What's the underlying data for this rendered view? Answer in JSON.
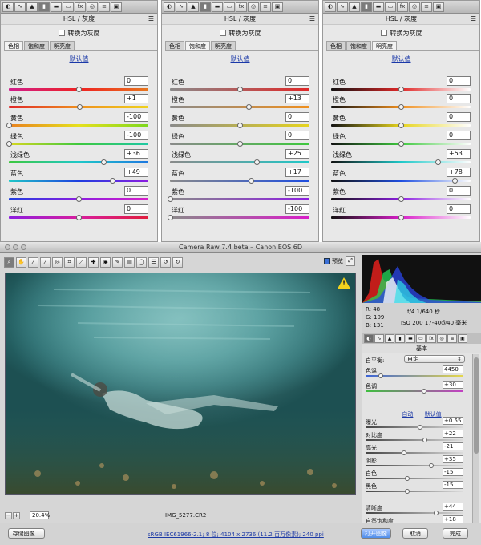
{
  "panels": [
    {
      "title": "HSL / 灰度",
      "grayscale_label": "转换为灰度",
      "tabs": [
        "色相",
        "饱和度",
        "明亮度"
      ],
      "active_tab": 0,
      "default_label": "默认值",
      "sliders": [
        {
          "label": "红色",
          "value": "0"
        },
        {
          "label": "橙色",
          "value": "+1"
        },
        {
          "label": "黄色",
          "value": "-100"
        },
        {
          "label": "绿色",
          "value": "-100"
        },
        {
          "label": "浅绿色",
          "value": "+36"
        },
        {
          "label": "蓝色",
          "value": "+49"
        },
        {
          "label": "紫色",
          "value": "0"
        },
        {
          "label": "洋红",
          "value": "0"
        }
      ]
    },
    {
      "title": "HSL / 灰度",
      "grayscale_label": "转换为灰度",
      "tabs": [
        "色相",
        "饱和度",
        "明亮度"
      ],
      "active_tab": 1,
      "default_label": "默认值",
      "sliders": [
        {
          "label": "红色",
          "value": "0"
        },
        {
          "label": "橙色",
          "value": "+13"
        },
        {
          "label": "黄色",
          "value": "0"
        },
        {
          "label": "绿色",
          "value": "0"
        },
        {
          "label": "浅绿色",
          "value": "+25"
        },
        {
          "label": "蓝色",
          "value": "+17"
        },
        {
          "label": "紫色",
          "value": "-100"
        },
        {
          "label": "洋红",
          "value": "-100"
        }
      ]
    },
    {
      "title": "HSL / 灰度",
      "grayscale_label": "转换为灰度",
      "tabs": [
        "色相",
        "饱和度",
        "明亮度"
      ],
      "active_tab": 2,
      "default_label": "默认值",
      "sliders": [
        {
          "label": "红色",
          "value": "0"
        },
        {
          "label": "橙色",
          "value": "0"
        },
        {
          "label": "黄色",
          "value": "0"
        },
        {
          "label": "绿色",
          "value": "0"
        },
        {
          "label": "浅绿色",
          "value": "+53"
        },
        {
          "label": "蓝色",
          "value": "+78"
        },
        {
          "label": "紫色",
          "value": "0"
        },
        {
          "label": "洋红",
          "value": "0"
        }
      ]
    }
  ],
  "camera_raw": {
    "title": "Camera Raw 7.4 beta – Canon EOS 6D",
    "preview_label": "预览",
    "zoom": "20.4%",
    "filename": "IMG_5277.CR2",
    "hist_info": {
      "r": "R:  48",
      "g": "G: 109",
      "b": "B: 131",
      "aperture_shutter": "f/4   1/640 秒",
      "iso_lens": "ISO 200   17-40@40 毫米"
    },
    "panel_name": "基本",
    "wb_label": "白平衡:",
    "wb_value": "自定",
    "auto_label": "自动",
    "default_label": "默认值",
    "temp_slider": {
      "label": "色温",
      "value": "4450"
    },
    "tint_slider": {
      "label": "色调",
      "value": "+30"
    },
    "sliders": [
      {
        "label": "曝光",
        "value": "+0.55"
      },
      {
        "label": "对比度",
        "value": "+22"
      },
      {
        "label": "高光",
        "value": "-21"
      },
      {
        "label": "阴影",
        "value": "+35"
      },
      {
        "label": "白色",
        "value": "-15"
      },
      {
        "label": "黑色",
        "value": "-15"
      },
      {
        "label": "清晰度",
        "value": "+44"
      },
      {
        "label": "自然饱和度",
        "value": "+18"
      },
      {
        "label": "饱和度",
        "value": "0"
      }
    ],
    "save_button": "存储图像...",
    "workflow_info": "sRGB IEC61966-2.1; 8 位; 4104 x 2736 (11.2 百万像素); 240 ppi",
    "open_button": "打开图像",
    "cancel_button": "取消",
    "done_button": "完成"
  },
  "colors": {
    "accent": "#1d3aa6",
    "warning": "#f2d21e",
    "photo": "#2f7476"
  }
}
